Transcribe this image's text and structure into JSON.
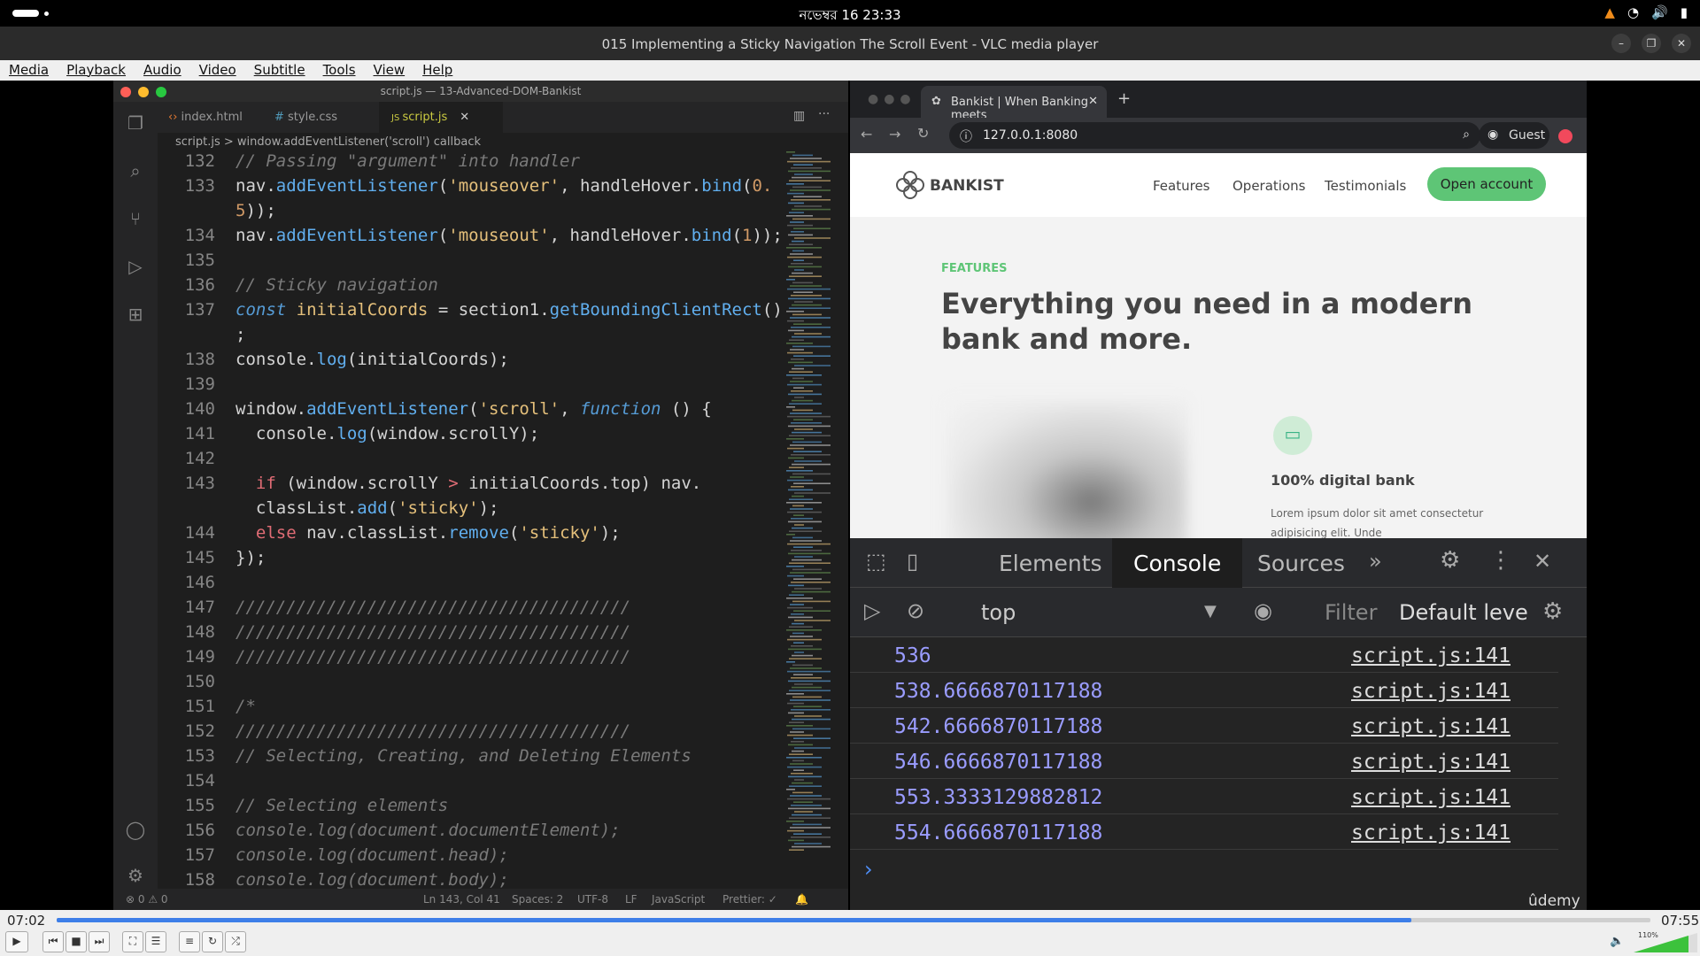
{
  "system": {
    "clock": "নভেম্বর 16  23:33"
  },
  "window": {
    "title": "015 Implementing a Sticky Navigation The Scroll Event - VLC media player"
  },
  "menu": [
    "Media",
    "Playback",
    "Audio",
    "Video",
    "Subtitle",
    "Tools",
    "View",
    "Help"
  ],
  "editor": {
    "title": "script.js — 13-Advanced-DOM-Bankist",
    "tabs": [
      "index.html",
      "style.css",
      "script.js"
    ],
    "breadcrumb": "script.js  >  window.addEventListener('scroll') callback",
    "lines": [
      {
        "n": "132",
        "html": "<span class='cm'>// Passing \"argument\" into handler</span>"
      },
      {
        "n": "133",
        "html": "nav.<span class='fn'>addEventListener</span>(<span class='st'>'mouseover'</span>, handleHover.<span class='fn'>bind</span>(<span class='nm'>0.</span>"
      },
      {
        "n": "",
        "html": "<span class='nm'>5</span>));"
      },
      {
        "n": "134",
        "html": "nav.<span class='fn'>addEventListener</span>(<span class='st'>'mouseout'</span>, handleHover.<span class='fn'>bind</span>(<span class='nm'>1</span>));"
      },
      {
        "n": "135",
        "html": ""
      },
      {
        "n": "136",
        "html": "<span class='cm'>// Sticky navigation</span>"
      },
      {
        "n": "137",
        "html": "<span class='kw'>const</span> <span class='vr'>initialCoords</span> = section1.<span class='fn'>getBoundingClientRect</span>()"
      },
      {
        "n": "",
        "html": ";"
      },
      {
        "n": "138",
        "html": "console.<span class='fn'>log</span>(initialCoords);"
      },
      {
        "n": "139",
        "html": ""
      },
      {
        "n": "140",
        "html": "window.<span class='fn'>addEventListener</span>(<span class='st'>'scroll'</span>, <span class='kw'>function</span> () {"
      },
      {
        "n": "141",
        "html": "  console.<span class='fn'>log</span>(window.scrollY);"
      },
      {
        "n": "142",
        "html": ""
      },
      {
        "n": "143",
        "html": "  <span class='kc'>if</span> (window.scrollY <span class='kc'>&gt;</span> initialCoords.top) nav."
      },
      {
        "n": "",
        "html": "  classList.<span class='fn'>add</span>(<span class='st'>'sticky'</span>);"
      },
      {
        "n": "144",
        "html": "  <span class='kc'>else</span> nav.classList.<span class='fn'>remove</span>(<span class='st'>'sticky'</span>);"
      },
      {
        "n": "145",
        "html": "});"
      },
      {
        "n": "146",
        "html": ""
      },
      {
        "n": "147",
        "html": "<span class='cm'>///////////////////////////////////////</span>"
      },
      {
        "n": "148",
        "html": "<span class='cm'>///////////////////////////////////////</span>"
      },
      {
        "n": "149",
        "html": "<span class='cm'>///////////////////////////////////////</span>"
      },
      {
        "n": "150",
        "html": ""
      },
      {
        "n": "151",
        "html": "<span class='cm'>/*</span>"
      },
      {
        "n": "152",
        "html": "<span class='cm'>///////////////////////////////////////</span>"
      },
      {
        "n": "153",
        "html": "<span class='cm'>// Selecting, Creating, and Deleting Elements</span>"
      },
      {
        "n": "154",
        "html": ""
      },
      {
        "n": "155",
        "html": "<span class='cm'>// Selecting elements</span>"
      },
      {
        "n": "156",
        "html": "<span class='cm'>console.log(document.documentElement);</span>"
      },
      {
        "n": "157",
        "html": "<span class='cm'>console.log(document.head);</span>"
      },
      {
        "n": "158",
        "html": "<span class='cm'>console.log(document.body);</span>"
      }
    ],
    "status": {
      "problems": "⊗ 0 ⚠ 0",
      "pos": "Ln 143, Col 41",
      "spaces": "Spaces: 2",
      "enc": "UTF-8",
      "eol": "LF",
      "lang": "JavaScript",
      "prettier": "Prettier: ✓"
    }
  },
  "browser": {
    "tab_title": "Bankist | When Banking meets",
    "url": "127.0.0.1:8080",
    "profile": "Guest",
    "site": {
      "logo": "BANKIST",
      "nav": [
        "Features",
        "Operations",
        "Testimonials"
      ],
      "cta": "Open account",
      "section_label": "FEATURES",
      "headline": "Everything you need in a modern bank and more.",
      "feature_title": "100% digital bank",
      "feature_text": "Lorem ipsum dolor sit amet consectetur adipisicing elit. Unde"
    }
  },
  "devtools": {
    "tabs": [
      "Elements",
      "Console",
      "Sources"
    ],
    "context": "top",
    "filter_placeholder": "Filter",
    "levels": "Default leve",
    "logs": [
      {
        "value": "536",
        "source": "script.js:141"
      },
      {
        "value": "538.6666870117188",
        "source": "script.js:141"
      },
      {
        "value": "542.6666870117188",
        "source": "script.js:141"
      },
      {
        "value": "546.6666870117188",
        "source": "script.js:141"
      },
      {
        "value": "553.3333129882812",
        "source": "script.js:141"
      },
      {
        "value": "554.6666870117188",
        "source": "script.js:141"
      }
    ]
  },
  "watermark": "ûdemy",
  "player": {
    "elapsed": "07:02",
    "total": "07:55",
    "progress": 0.85,
    "volume_label": "110%"
  }
}
